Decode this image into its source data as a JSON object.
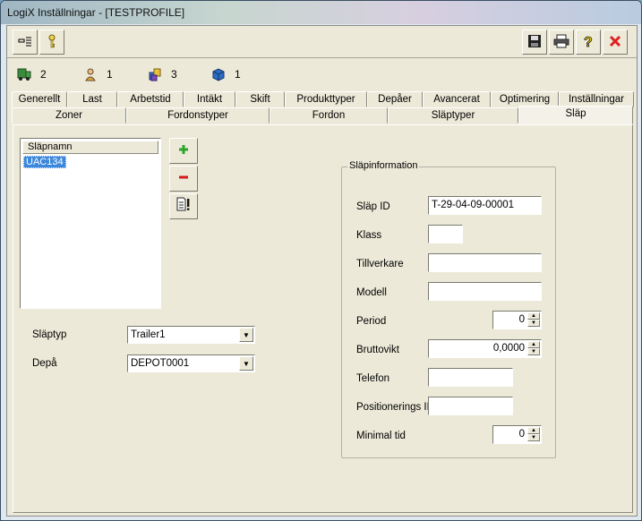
{
  "window": {
    "title": "LogiX Inställningar - [TESTPROFILE]"
  },
  "toolbar": {
    "left_buttons": [
      {
        "name": "list-settings-icon"
      },
      {
        "name": "key-icon"
      }
    ],
    "right_buttons": [
      {
        "name": "save-icon"
      },
      {
        "name": "print-icon"
      },
      {
        "name": "help-icon"
      },
      {
        "name": "close-icon"
      }
    ]
  },
  "status": {
    "items": [
      {
        "icon": "vehicle-icon",
        "count": "2"
      },
      {
        "icon": "driver-icon",
        "count": "1"
      },
      {
        "icon": "stack-icon",
        "count": "3"
      },
      {
        "icon": "box-icon",
        "count": "1"
      }
    ]
  },
  "tabs": {
    "row1": [
      "Generellt",
      "Last",
      "Arbetstid",
      "Intäkt",
      "Skift",
      "Produkttyper",
      "Depåer",
      "Avancerat",
      "Optimering",
      "Inställningar"
    ],
    "row2": [
      "Zoner",
      "Fordonstyper",
      "Fordon",
      "Släptyper",
      "Släp"
    ],
    "active": "Släp"
  },
  "list": {
    "header": "Släpnamn",
    "items": [
      "UAC134"
    ],
    "selected": "UAC134"
  },
  "side_buttons": {
    "add": "+",
    "remove": "−"
  },
  "form_left": {
    "slaptyp_label": "Släptyp",
    "slaptyp_value": "Trailer1",
    "depa_label": "Depå",
    "depa_value": "DEPOT0001"
  },
  "info": {
    "title": "Släpinformation",
    "fields": {
      "slap_id_label": "Släp ID",
      "slap_id_value": "T-29-04-09-00001",
      "klass_label": "Klass",
      "klass_value": "",
      "tillverkare_label": "Tillverkare",
      "tillverkare_value": "",
      "modell_label": "Modell",
      "modell_value": "",
      "period_label": "Period",
      "period_value": "0",
      "bruttovikt_label": "Bruttovikt",
      "bruttovikt_value": "0,0000",
      "telefon_label": "Telefon",
      "telefon_value": "",
      "positionerings_label": "Positionerings ID",
      "positionerings_value": "",
      "minimal_label": "Minimal tid",
      "minimal_value": "0"
    }
  },
  "colors": {
    "selection": "#3c88dc",
    "close_red": "#e02020",
    "add_green": "#2aa52a",
    "remove_red": "#d21c1c"
  }
}
